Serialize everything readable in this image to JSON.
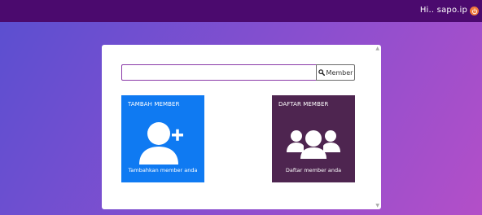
{
  "header": {
    "greeting": "Hi.. sapo.ip",
    "power_icon": "power-icon",
    "background": "#4b0a6e"
  },
  "search": {
    "value": "",
    "placeholder": "",
    "button_label": "Member",
    "button_icon": "search-icon"
  },
  "cards": [
    {
      "title": "TAMBAH MEMBER",
      "caption": "Tambahkan member anda",
      "icon": "add-user-icon",
      "color": "#0f7af2"
    },
    {
      "title": "DAFTAR MEMBER",
      "caption": "Daftar member anda",
      "icon": "users-group-icon",
      "color": "#4e2550"
    }
  ]
}
